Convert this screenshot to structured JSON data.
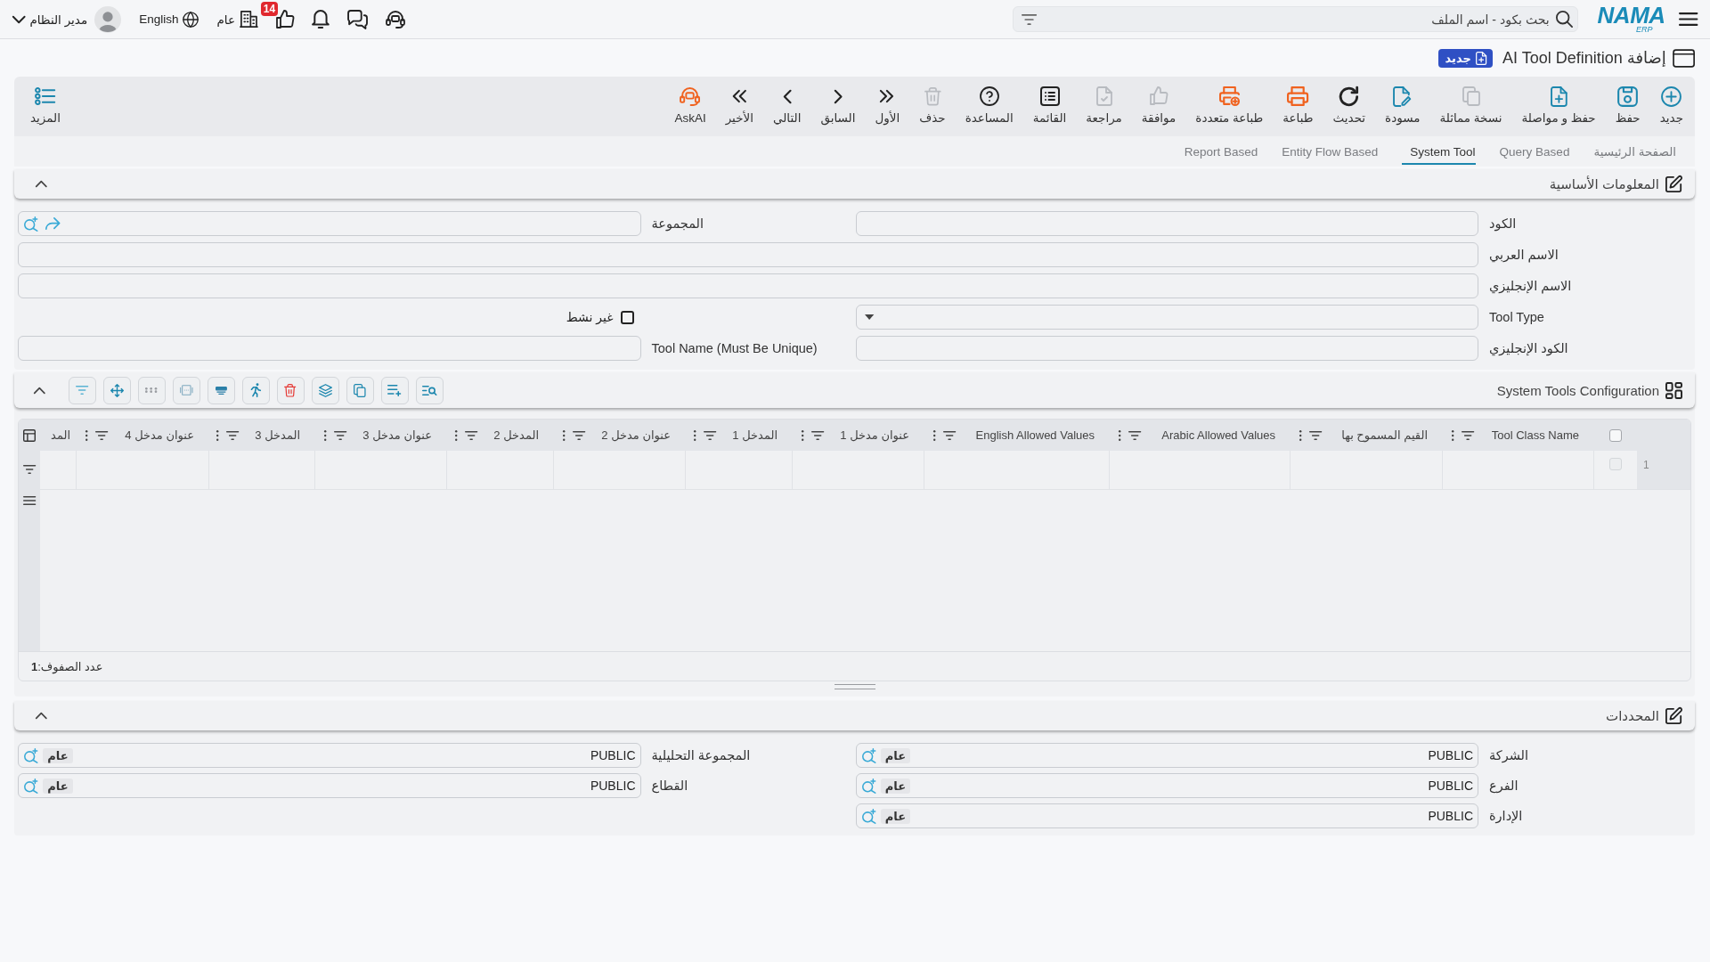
{
  "top_bar": {
    "logo": {
      "name": "NAMA",
      "sub": "ERP"
    },
    "search": {
      "placeholder": "بحث بكود - اسم الملف"
    },
    "notification_count": "14",
    "company": "عام",
    "language": "English",
    "user": "مدير النظام"
  },
  "page_title": {
    "title": "إضافة AI Tool Definition",
    "badge": "جديد"
  },
  "toolbar": {
    "buttons": [
      {
        "label": "جديد",
        "disabled": false
      },
      {
        "label": "حفظ",
        "disabled": false
      },
      {
        "label": "حفظ و مواصلة",
        "disabled": false
      },
      {
        "label": "نسخة مماثلة",
        "disabled": true
      },
      {
        "label": "مسودة",
        "disabled": false
      },
      {
        "label": "تحديث",
        "disabled": false
      },
      {
        "label": "طباعة",
        "disabled": false
      },
      {
        "label": "طباعة متعددة",
        "disabled": false
      },
      {
        "label": "موافقة",
        "disabled": true
      },
      {
        "label": "مراجعة",
        "disabled": true
      },
      {
        "label": "القائمة",
        "disabled": false
      },
      {
        "label": "المساعدة",
        "disabled": false
      },
      {
        "label": "حذف",
        "disabled": true
      },
      {
        "label": "الأول",
        "disabled": false
      },
      {
        "label": "السابق",
        "disabled": false
      },
      {
        "label": "التالي",
        "disabled": false
      },
      {
        "label": "الأخير",
        "disabled": false
      },
      {
        "label": "AskAI",
        "disabled": false
      }
    ],
    "more": "المزيد"
  },
  "tabs": [
    {
      "label": "الصفحة الرئيسية",
      "selected": false
    },
    {
      "label": "Query Based",
      "selected": false
    },
    {
      "label": "System Tool",
      "selected": true
    },
    {
      "label": "Entity Flow Based",
      "selected": false
    },
    {
      "label": "Report Based",
      "selected": false
    }
  ],
  "basic_info": {
    "title": "المعلومات الأساسية",
    "expanded": true,
    "rows": [
      {
        "fields": [
          {
            "kind": "text",
            "label": "الكود"
          },
          {
            "kind": "lookup",
            "label": "المجموعة"
          }
        ]
      },
      {
        "fields": [
          {
            "kind": "text",
            "label": "الاسم العربي"
          }
        ]
      },
      {
        "fields": [
          {
            "kind": "text",
            "label": "الاسم الإنجليزي"
          }
        ]
      },
      {
        "fields": [
          {
            "kind": "select",
            "label": "Tool Type"
          },
          {
            "kind": "checkbox",
            "label": "غير نشط",
            "checked": false
          }
        ]
      },
      {
        "fields": [
          {
            "kind": "text",
            "label": "الكود الإنجليزي"
          },
          {
            "kind": "text",
            "label": "Tool Name (Must Be Unique)"
          }
        ]
      }
    ]
  },
  "configuration": {
    "title": "System Tools Configuration",
    "expanded": true,
    "header_checked": false,
    "columns": [
      "Tool Class Name",
      "القيم المسموح بها",
      "Arabic Allowed Values",
      "English Allowed Values",
      "عنوان مدخل 1",
      "المدخل 1",
      "عنوان مدخل 2",
      "المدخل 2",
      "عنوان مدخل 3",
      "المدخل 3",
      "عنوان مدخل 4",
      "المد"
    ],
    "rows": [
      {
        "number": "1",
        "checked": false
      }
    ],
    "footer": "عدد الصفوف:**1**"
  },
  "determinants": {
    "title": "المحددات",
    "expanded": true,
    "fields": [
      {
        "label": "الشركة",
        "value": "PUBLIC",
        "tag": "عام"
      },
      {
        "label": "المجموعة التحليلية",
        "value": "PUBLIC",
        "tag": "عام"
      },
      {
        "label": "الفرع",
        "value": "PUBLIC",
        "tag": "عام"
      },
      {
        "label": "القطاع",
        "value": "PUBLIC",
        "tag": "عام"
      },
      {
        "label": "الإدارة",
        "value": "PUBLIC",
        "tag": "عام"
      }
    ]
  }
}
